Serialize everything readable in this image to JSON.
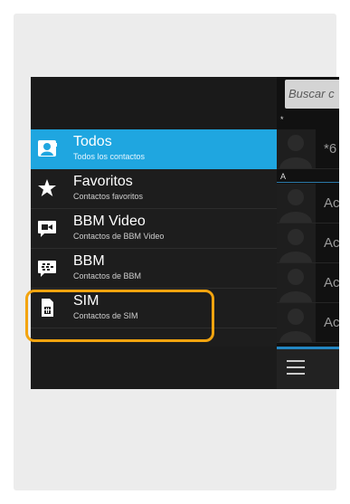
{
  "drawer": {
    "items": [
      {
        "title": "Todos",
        "subtitle": "Todos los contactos",
        "icon": "contact-card-icon",
        "selected": true
      },
      {
        "title": "Favoritos",
        "subtitle": "Contactos favoritos",
        "icon": "star-icon",
        "selected": false
      },
      {
        "title": "BBM Video",
        "subtitle": "Contactos de BBM Video",
        "icon": "video-camera-icon",
        "selected": false
      },
      {
        "title": "BBM",
        "subtitle": "Contactos de BBM",
        "icon": "bbm-icon",
        "selected": false
      },
      {
        "title": "SIM",
        "subtitle": "Contactos de SIM",
        "icon": "sim-card-icon",
        "selected": false
      }
    ]
  },
  "search": {
    "placeholder": "Buscar c"
  },
  "contacts": {
    "section_star": "*",
    "section_a": "A",
    "rows": [
      {
        "name": "*6"
      },
      {
        "name": "Ac"
      },
      {
        "name": "Ac"
      },
      {
        "name": "Ac"
      },
      {
        "name": "Ac"
      }
    ]
  },
  "colors": {
    "accent": "#1fa6e0",
    "highlight": "#f3a40f",
    "drawer_bg": "#1d1d1d",
    "card_bg": "#ececec"
  },
  "icons": {
    "menu": "hamburger-menu-icon",
    "avatar": "person-silhouette-icon"
  }
}
